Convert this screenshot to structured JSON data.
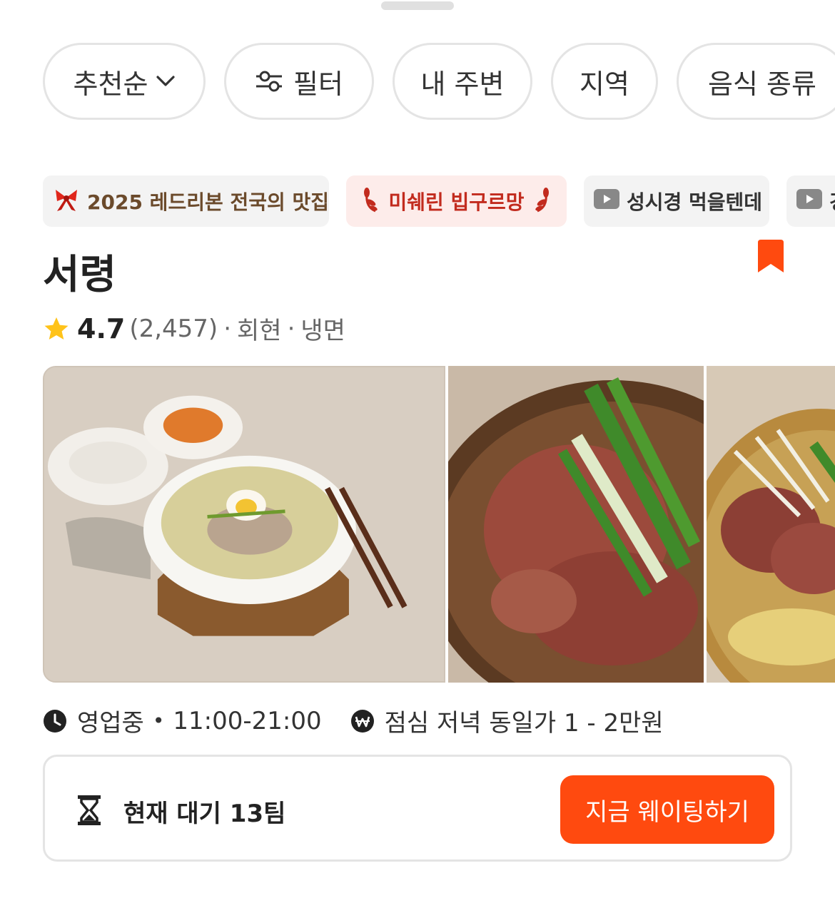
{
  "filters": {
    "sort_label": "추천순",
    "filter_label": "필터",
    "nearby_label": "내 주변",
    "region_label": "지역",
    "food_type_label": "음식 종류"
  },
  "badges": {
    "ribbon": "2025 레드리본 전국의 맛집",
    "bib_gourmand": "미쉐린 빕구르망",
    "video_1": "성시경 먹을텐데",
    "video_2": "경"
  },
  "restaurant": {
    "name": "서령",
    "rating": "4.7",
    "review_count": "(2,457)",
    "location": "회현",
    "category": "냉면",
    "separator": "·"
  },
  "hours": {
    "status": "영업중",
    "dot": "•",
    "time": "11:00-21:00"
  },
  "price": {
    "text": "점심 저녁 동일가 1 - 2만원"
  },
  "waiting": {
    "text": "현재 대기 13팀",
    "button_label": "지금 웨이팅하기"
  },
  "colors": {
    "accent": "#ff4a0f",
    "bookmark": "#ff4a0f",
    "star": "#ffc31a",
    "ribbon_text": "#6b4a2b",
    "bib_text": "#c22b1e",
    "bib_bg": "#fdecea"
  }
}
